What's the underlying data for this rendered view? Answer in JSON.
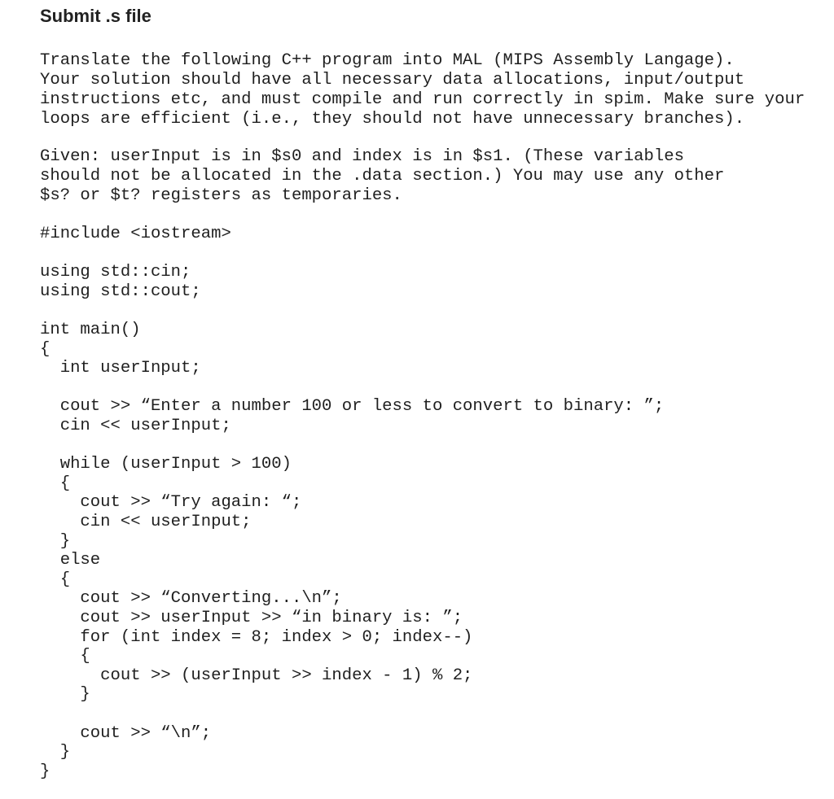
{
  "header": {
    "title": "Submit .s file"
  },
  "instructions": {
    "paragraph_1": [
      "Translate the following C++ program into MAL (MIPS Assembly Langage).",
      "Your solution should have all necessary data allocations, input/output",
      "instructions etc, and must compile and run correctly in spim. Make sure your",
      "loops are efficient (i.e., they should not have unnecessary branches)."
    ],
    "paragraph_2": [
      "Given: userInput is in $s0 and index is in $s1. (These variables",
      "should not be allocated in the .data section.) You may use any other",
      "$s? or $t? registers as temporaries."
    ]
  },
  "code": {
    "lines": [
      "#include <iostream>",
      "",
      "using std::cin;",
      "using std::cout;",
      "",
      "int main()",
      "{",
      "  int userInput;",
      "",
      "  cout >> “Enter a number 100 or less to convert to binary: ”;",
      "  cin << userInput;",
      "",
      "  while (userInput > 100)",
      "  {",
      "    cout >> “Try again: “;",
      "    cin << userInput;",
      "  }",
      "  else",
      "  {",
      "    cout >> “Converting...\\n”;",
      "    cout >> userInput >> “in binary is: ”;",
      "    for (int index = 8; index > 0; index--)",
      "    {",
      "      cout >> (userInput >> index - 1) % 2;",
      "    }",
      "",
      "    cout >> “\\n”;",
      "  }",
      "}"
    ]
  }
}
